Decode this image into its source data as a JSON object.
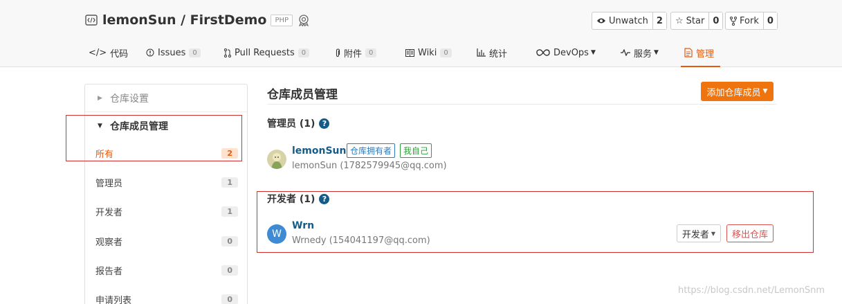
{
  "repo": {
    "owner_repo": "lemonSun / FirstDemo",
    "language": "PHP"
  },
  "actions": {
    "watch": {
      "label": "Unwatch",
      "count": "2"
    },
    "star": {
      "label": "Star",
      "count": "0"
    },
    "fork": {
      "label": "Fork",
      "count": "0"
    }
  },
  "tabs": [
    {
      "label": "代码"
    },
    {
      "label": "Issues",
      "badge": "0"
    },
    {
      "label": "Pull Requests",
      "badge": "0"
    },
    {
      "label": "附件",
      "badge": "0"
    },
    {
      "label": "Wiki",
      "badge": "0"
    },
    {
      "label": "统计"
    },
    {
      "label": "DevOps"
    },
    {
      "label": "服务"
    },
    {
      "label": "管理"
    }
  ],
  "sidebar": {
    "repo_settings": "仓库设置",
    "members_header": "仓库成员管理",
    "items": [
      {
        "label": "所有",
        "count": "2"
      },
      {
        "label": "管理员",
        "count": "1"
      },
      {
        "label": "开发者",
        "count": "1"
      },
      {
        "label": "观察者",
        "count": "0"
      },
      {
        "label": "报告者",
        "count": "0"
      },
      {
        "label": "申请列表",
        "count": "0"
      }
    ]
  },
  "main": {
    "title": "仓库成员管理",
    "add_button": "添加仓库成员",
    "admin_section": "管理员 (1)",
    "developer_section": "开发者 (1)",
    "admin_member": {
      "name": "lemonSun",
      "sub": "lemonSun (1782579945@qq.com)",
      "tag_owner": "仓库拥有者",
      "tag_self": "我自己"
    },
    "dev_member": {
      "avatar_letter": "W",
      "name": "Wrn",
      "sub": "Wrnedy (154041197@qq.com)",
      "role": "开发者",
      "remove": "移出仓库"
    }
  },
  "watermark": "https://blog.csdn.net/LemonSnm",
  "colors": {
    "accent": "#e8590c",
    "button_orange": "#f0740e",
    "link_blue": "#135c8a",
    "highlight_red": "#d32f2f"
  }
}
